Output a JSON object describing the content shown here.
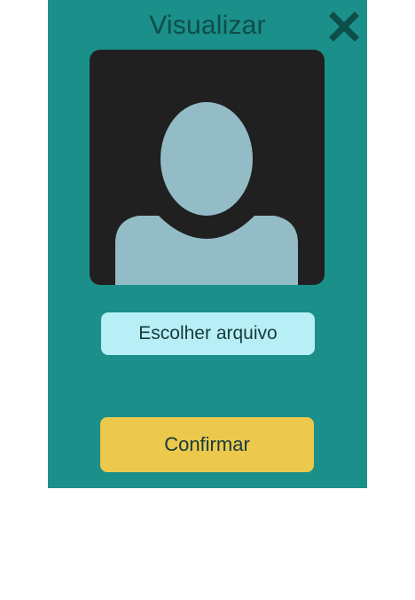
{
  "dialog": {
    "title": "Visualizar",
    "close_icon": "close-icon",
    "avatar_icon": "user-silhouette-icon"
  },
  "actions": {
    "choose_file_label": "Escolher arquivo",
    "confirm_label": "Confirmar"
  },
  "colors": {
    "panel": "#1b8f8a",
    "title": "#0d4d4a",
    "avatar_bg": "#202020",
    "avatar_figure": "#93bcc6",
    "file_button": "#b8eff7",
    "confirm_button": "#ecc84c"
  }
}
